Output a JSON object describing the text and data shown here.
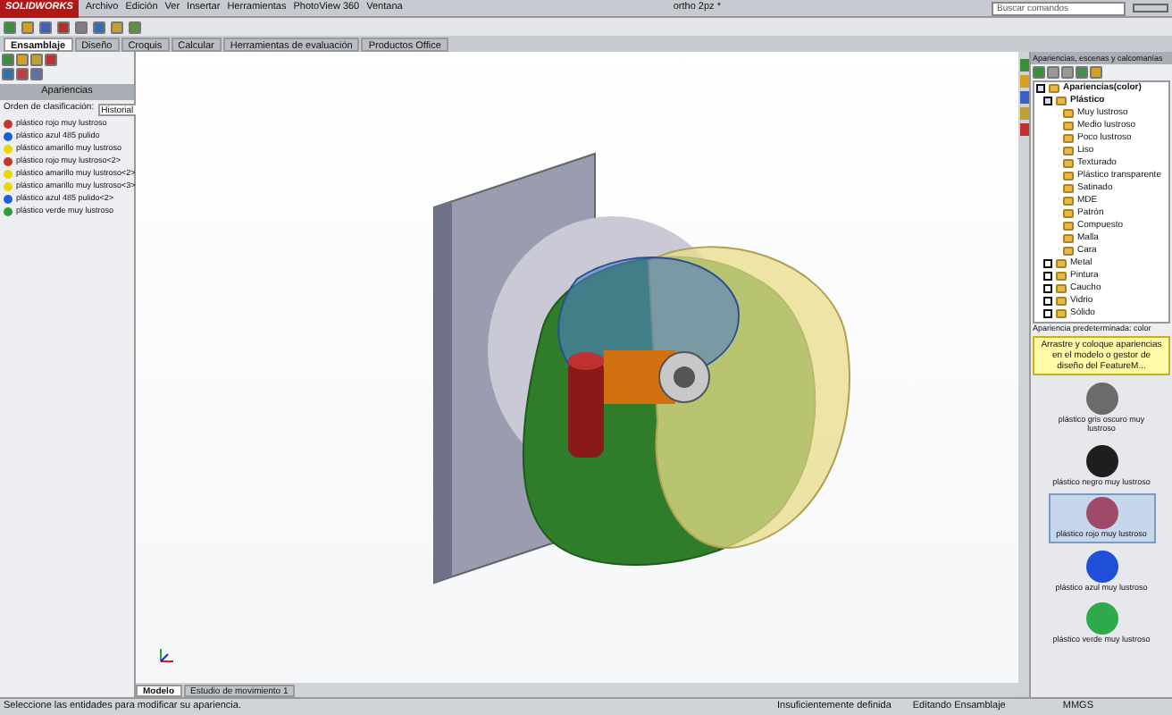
{
  "app": {
    "logo": "SOLIDWORKS",
    "menus": [
      "Archivo",
      "Edición",
      "Ver",
      "Insertar",
      "Herramientas",
      "PhotoView 360",
      "Ventana"
    ],
    "title": "ortho 2pz *",
    "search": {
      "placeholder": "Buscar comandos"
    }
  },
  "tabs": [
    {
      "label": "Ensamblaje",
      "selected": true
    },
    {
      "label": "Diseño",
      "selected": false
    },
    {
      "label": "Croquis",
      "selected": false
    },
    {
      "label": "Calcular",
      "selected": false
    },
    {
      "label": "Herramientas de evaluación",
      "selected": false
    },
    {
      "label": "Productos Office",
      "selected": false
    }
  ],
  "left_panel": {
    "title": "Apariencias",
    "sort_label": "Orden de clasificación:",
    "sort_value": "Historial",
    "items": [
      {
        "label": "plástico rojo muy lustroso",
        "color": "#c0392b"
      },
      {
        "label": "plástico azul 485 pulido",
        "color": "#1f5fd6"
      },
      {
        "label": "plástico amarillo muy lustroso",
        "color": "#e8d800"
      },
      {
        "label": "plástico rojo muy lustroso<2>",
        "color": "#c0392b"
      },
      {
        "label": "plástico amarillo muy lustroso<2>",
        "color": "#e8d800"
      },
      {
        "label": "plástico amarillo muy lustroso<3>",
        "color": "#e8d800"
      },
      {
        "label": "plástico azul 485 pulido<2>",
        "color": "#1f5fd6"
      },
      {
        "label": "plástico verde muy lustroso",
        "color": "#2e9e3a"
      }
    ]
  },
  "right_panel": {
    "title": "Apariencias, escenas y calcomanías",
    "tree": [
      {
        "label": "Apariencias(color)",
        "expanded": true,
        "children": [
          {
            "label": "Plástico",
            "expanded": true,
            "children": [
              {
                "label": "Muy lustroso"
              },
              {
                "label": "Medio lustroso"
              },
              {
                "label": "Poco lustroso"
              },
              {
                "label": "Liso"
              },
              {
                "label": "Texturado"
              },
              {
                "label": "Plástico transparente"
              },
              {
                "label": "Satinado"
              },
              {
                "label": "MDE"
              },
              {
                "label": "Patrón"
              },
              {
                "label": "Compuesto"
              },
              {
                "label": "Malla"
              },
              {
                "label": "Cara"
              }
            ]
          },
          {
            "label": "Metal",
            "expanded": false
          },
          {
            "label": "Pintura",
            "expanded": false
          },
          {
            "label": "Caucho",
            "expanded": false
          },
          {
            "label": "Vidrio",
            "expanded": false
          },
          {
            "label": "Sólido",
            "expanded": false
          }
        ]
      }
    ],
    "default_label": "Apariencia predeterminada: color",
    "hint": "Arrastre y coloque apariencias en el modelo o gestor de diseño del FeatureM...",
    "swatches": [
      {
        "label": "plástico gris oscuro muy lustroso",
        "color": "#6b6b6b",
        "selected": false
      },
      {
        "label": "plástico negro muy lustroso",
        "color": "#1e1e1e",
        "selected": false
      },
      {
        "label": "plástico rojo muy lustroso",
        "color": "#a04a6a",
        "selected": true
      },
      {
        "label": "plástico azul muy lustroso",
        "color": "#1f4fd8",
        "selected": false
      },
      {
        "label": "plástico verde muy lustroso",
        "color": "#2faa4a",
        "selected": false
      }
    ]
  },
  "bottom_tabs": [
    {
      "label": "Modelo",
      "selected": true
    },
    {
      "label": "Estudio de movimiento 1",
      "selected": false
    }
  ],
  "status_bar": {
    "message": "Seleccione las entidades para modificar su apariencia.",
    "definition": "Insuficientemente definida",
    "mode": "Editando Ensamblaje",
    "units": "MMGS"
  }
}
